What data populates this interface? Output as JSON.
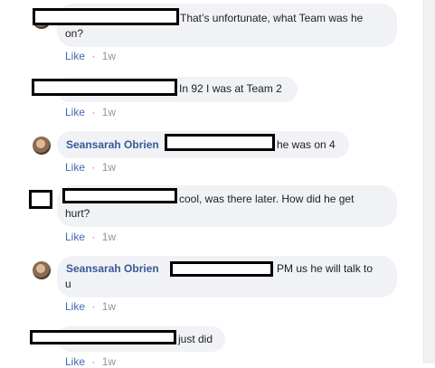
{
  "comments": [
    {
      "text_line1": "That’s unfortunate, what Team was he",
      "text_line2": "on?",
      "like": "Like",
      "sep": "·",
      "time": "1w"
    },
    {
      "text": "In 92 I was at Team 2",
      "like": "Like",
      "sep": "·",
      "time": "1w"
    },
    {
      "author": "Seansarah Obrien",
      "text": "he was on 4",
      "like": "Like",
      "sep": "·",
      "time": "1w"
    },
    {
      "text_line1": "cool, was there later. How did he get",
      "text_line2": "hurt?",
      "like": "Like",
      "sep": "·",
      "time": "1w"
    },
    {
      "author": "Seansarah Obrien",
      "text_line1": "PM us he will talk to",
      "text_line2": "u",
      "like": "Like",
      "sep": "·",
      "time": "1w"
    },
    {
      "text": "just did",
      "like": "Like",
      "sep": "·",
      "time": "1w"
    }
  ]
}
